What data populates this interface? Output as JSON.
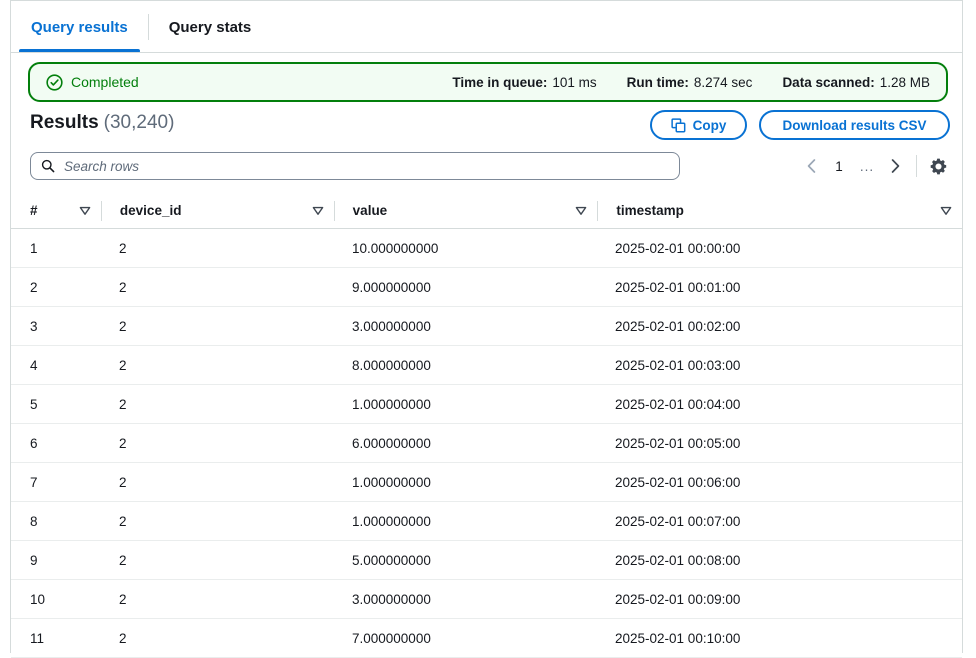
{
  "tabs": [
    {
      "label": "Query results",
      "active": true
    },
    {
      "label": "Query stats",
      "active": false
    }
  ],
  "alert": {
    "status_label": "Completed",
    "status_icon": "check-circle-icon",
    "metrics": [
      {
        "label": "Time in queue:",
        "value": "101 ms"
      },
      {
        "label": "Run time:",
        "value": "8.274 sec"
      },
      {
        "label": "Data scanned:",
        "value": "1.28 MB"
      }
    ],
    "border_color": "#037f0c",
    "background_color": "#f2fcf3"
  },
  "results": {
    "title": "Results",
    "count": "(30,240)"
  },
  "actions": {
    "copy_label": "Copy",
    "copy_icon": "copy-icon",
    "download_label": "Download results CSV",
    "accent_color": "#0972d3"
  },
  "search": {
    "placeholder": "Search rows",
    "value": "",
    "icon": "search-icon"
  },
  "pagination": {
    "prev_icon": "chevron-left-icon",
    "next_icon": "chevron-right-icon",
    "current_page": "1",
    "ellipsis": "...",
    "settings_icon": "gear-icon"
  },
  "table": {
    "columns": [
      {
        "key": "num",
        "label": "#"
      },
      {
        "key": "device_id",
        "label": "device_id"
      },
      {
        "key": "value",
        "label": "value"
      },
      {
        "key": "timestamp",
        "label": "timestamp"
      }
    ],
    "rows": [
      {
        "num": "1",
        "device_id": "2",
        "value": "10.000000000",
        "timestamp": "2025-02-01 00:00:00"
      },
      {
        "num": "2",
        "device_id": "2",
        "value": "9.000000000",
        "timestamp": "2025-02-01 00:01:00"
      },
      {
        "num": "3",
        "device_id": "2",
        "value": "3.000000000",
        "timestamp": "2025-02-01 00:02:00"
      },
      {
        "num": "4",
        "device_id": "2",
        "value": "8.000000000",
        "timestamp": "2025-02-01 00:03:00"
      },
      {
        "num": "5",
        "device_id": "2",
        "value": "1.000000000",
        "timestamp": "2025-02-01 00:04:00"
      },
      {
        "num": "6",
        "device_id": "2",
        "value": "6.000000000",
        "timestamp": "2025-02-01 00:05:00"
      },
      {
        "num": "7",
        "device_id": "2",
        "value": "1.000000000",
        "timestamp": "2025-02-01 00:06:00"
      },
      {
        "num": "8",
        "device_id": "2",
        "value": "1.000000000",
        "timestamp": "2025-02-01 00:07:00"
      },
      {
        "num": "9",
        "device_id": "2",
        "value": "5.000000000",
        "timestamp": "2025-02-01 00:08:00"
      },
      {
        "num": "10",
        "device_id": "2",
        "value": "3.000000000",
        "timestamp": "2025-02-01 00:09:00"
      },
      {
        "num": "11",
        "device_id": "2",
        "value": "7.000000000",
        "timestamp": "2025-02-01 00:10:00"
      }
    ]
  }
}
